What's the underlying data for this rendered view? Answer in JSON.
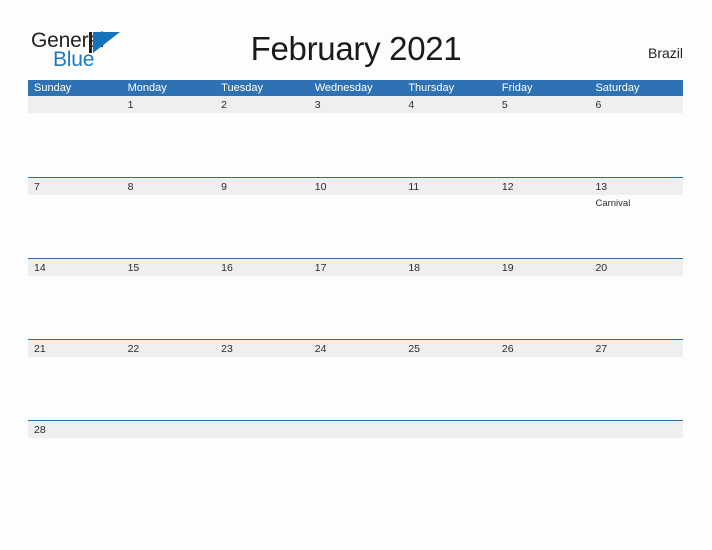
{
  "brand": {
    "line1": "General",
    "line2": "Blue",
    "mark_icon": "blue-flag-triangle-icon",
    "color_dark": "#231f20",
    "color_blue": "#1573bb"
  },
  "header": {
    "title": "February 2021",
    "country": "Brazil"
  },
  "theme": {
    "header_blue": "#2f72b4",
    "row_divider_blue": "#2c6ca8",
    "day_band_gray": "#efefef",
    "page_background": "#fdfdfe",
    "text_dark": "#2b2b2b"
  },
  "calendar": {
    "month": "February",
    "year": "2021",
    "weekdays": [
      "Sunday",
      "Monday",
      "Tuesday",
      "Wednesday",
      "Thursday",
      "Friday",
      "Saturday"
    ],
    "weeks": [
      {
        "days": [
          {
            "num": "",
            "events": []
          },
          {
            "num": "1",
            "events": []
          },
          {
            "num": "2",
            "events": []
          },
          {
            "num": "3",
            "events": []
          },
          {
            "num": "4",
            "events": []
          },
          {
            "num": "5",
            "events": []
          },
          {
            "num": "6",
            "events": []
          }
        ]
      },
      {
        "days": [
          {
            "num": "7",
            "events": []
          },
          {
            "num": "8",
            "events": []
          },
          {
            "num": "9",
            "events": []
          },
          {
            "num": "10",
            "events": []
          },
          {
            "num": "11",
            "events": []
          },
          {
            "num": "12",
            "events": []
          },
          {
            "num": "13",
            "events": [
              "Carnival"
            ]
          }
        ]
      },
      {
        "days": [
          {
            "num": "14",
            "events": []
          },
          {
            "num": "15",
            "events": []
          },
          {
            "num": "16",
            "events": []
          },
          {
            "num": "17",
            "events": []
          },
          {
            "num": "18",
            "events": []
          },
          {
            "num": "19",
            "events": []
          },
          {
            "num": "20",
            "events": []
          }
        ]
      },
      {
        "days": [
          {
            "num": "21",
            "events": []
          },
          {
            "num": "22",
            "events": []
          },
          {
            "num": "23",
            "events": []
          },
          {
            "num": "24",
            "events": []
          },
          {
            "num": "25",
            "events": []
          },
          {
            "num": "26",
            "events": []
          },
          {
            "num": "27",
            "events": []
          }
        ]
      },
      {
        "short": true,
        "days": [
          {
            "num": "28",
            "events": []
          },
          {
            "num": "",
            "events": []
          },
          {
            "num": "",
            "events": []
          },
          {
            "num": "",
            "events": []
          },
          {
            "num": "",
            "events": []
          },
          {
            "num": "",
            "events": []
          },
          {
            "num": "",
            "events": []
          }
        ]
      }
    ]
  }
}
